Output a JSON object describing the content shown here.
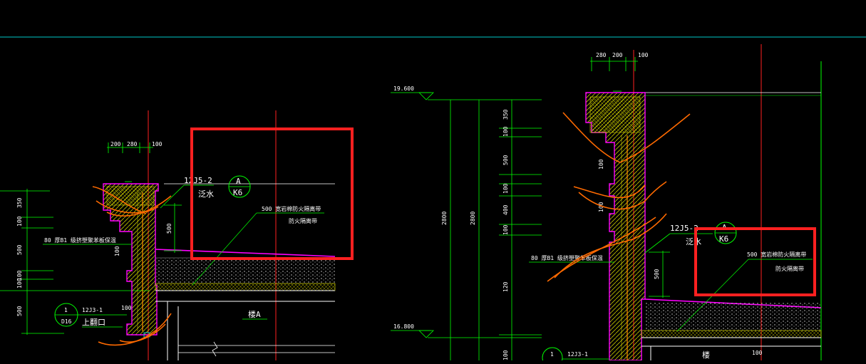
{
  "drawing": {
    "elevations": [
      "19.600",
      "16.800"
    ],
    "left_detail": {
      "dims_top": [
        "200",
        "280",
        "100"
      ],
      "dims_left": [
        "350",
        "100",
        "500",
        "100",
        "100",
        "500"
      ],
      "dim_500": "500",
      "dim_100": "100",
      "dim_100b": "100",
      "ref_code": "12J5-2",
      "ref_text": "泛水",
      "callout_top": "A",
      "callout_bottom": "K6",
      "insul_note": "80 厚B1 级挤塑聚苯板保温",
      "fire_note_1": "500 宽岩棉防火隔离带",
      "fire_note_2": "防火隔离带",
      "section_num": "1",
      "section_sheet": "D16",
      "section_code": "12J3-1",
      "section_text": "上翻口",
      "room_label": "楼A"
    },
    "right_detail": {
      "dims_top": [
        "280",
        "200",
        "100"
      ],
      "dims_left": [
        "350",
        "100",
        "500",
        "100",
        "400",
        "100",
        "120"
      ],
      "dim_2800a": "2800",
      "dim_2800b": "2800",
      "dim_100": "100",
      "dim_100b": "100",
      "dim_500": "500",
      "dim_100c": "100",
      "dim_100d": "100",
      "ref_code": "12J5-2",
      "ref_text": "泛水",
      "callout_top": "A",
      "callout_bottom": "K6",
      "insul_note": "80 厚B1 级挤塑聚苯板保温",
      "fire_note_1": "500 宽岩棉防火隔离带",
      "fire_note_2": "防火隔离带",
      "section_num": "1",
      "section_code": "12J3-1",
      "room_label": "楼"
    },
    "colors": {
      "background": "#000000",
      "green": "#00ff00",
      "red": "#ff2020",
      "magenta": "#ff00ff",
      "yellow": "#c8c800",
      "orange": "#ff6a00",
      "cyan": "#00c8c8",
      "white": "#ffffff"
    }
  }
}
